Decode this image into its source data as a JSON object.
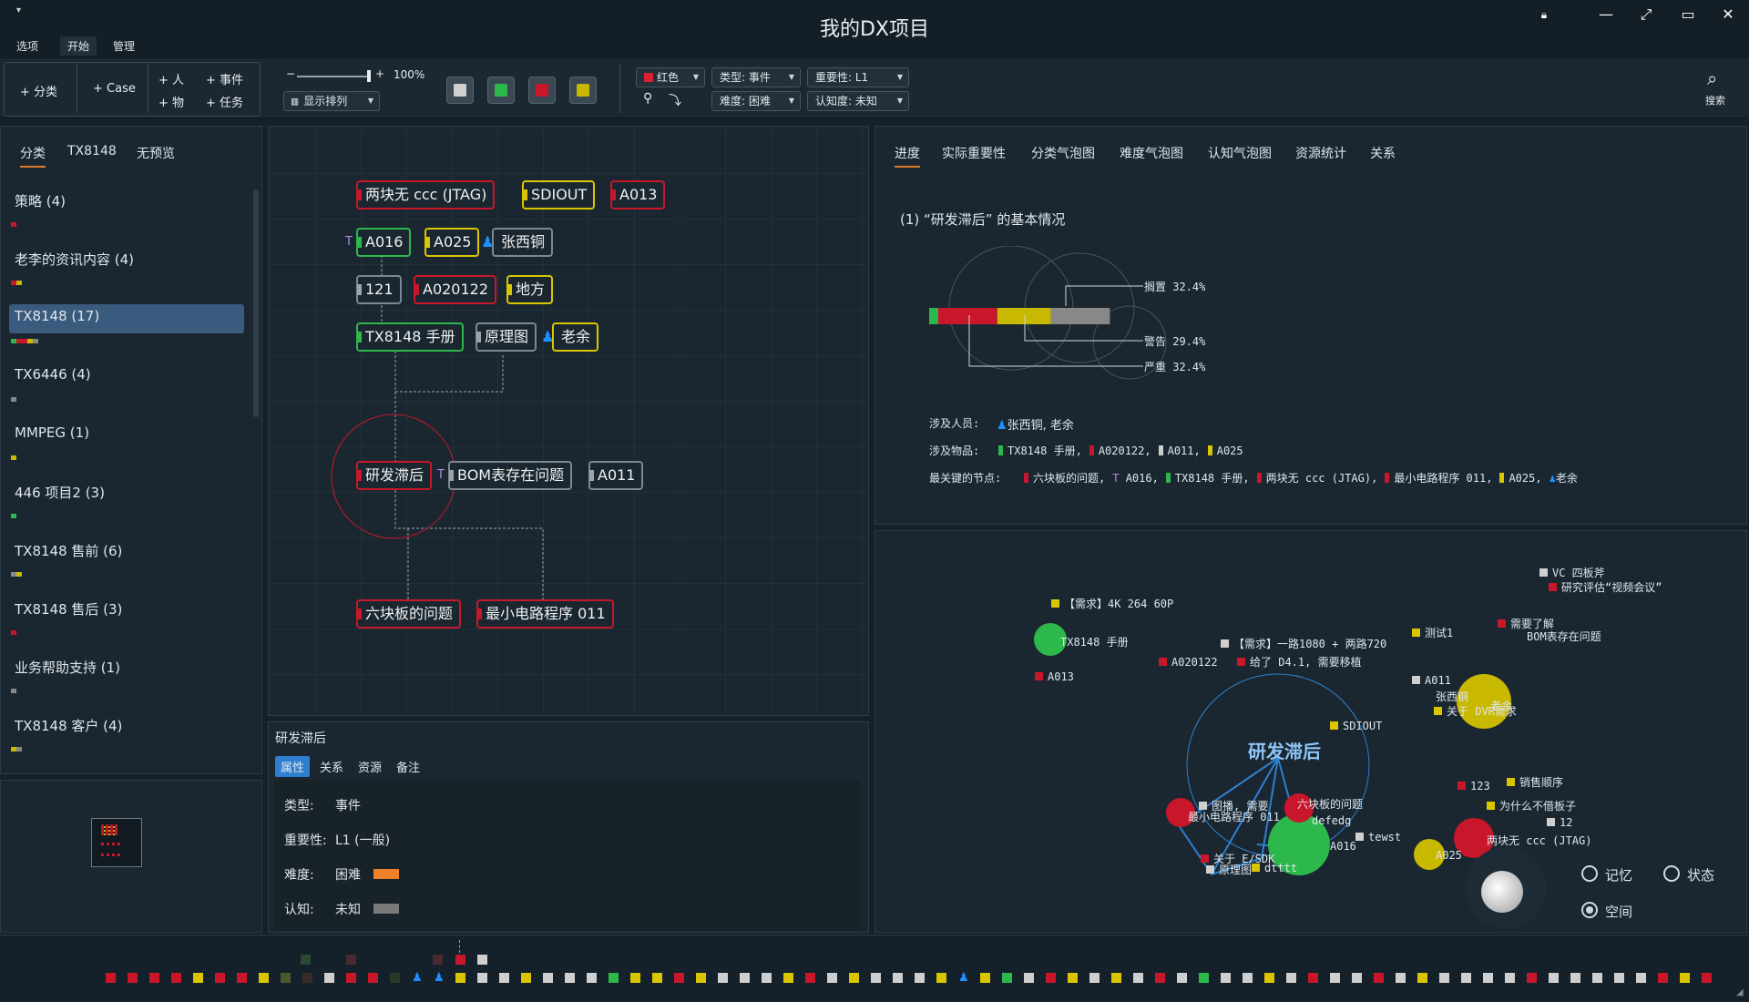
{
  "window": {
    "title": "我的DX项目"
  },
  "menu": [
    "选项",
    "开始",
    "管理"
  ],
  "ribbon": {
    "add_category": "+ 分类",
    "add_case": "+ Case",
    "add_person": "+ 人",
    "add_event": "+ 事件",
    "add_item": "+ 物",
    "add_task": "+ 任务",
    "zoom": "100%",
    "zoom_minus": "−",
    "zoom_plus": "+",
    "display_mode": "显示排列",
    "color_filter": "红色",
    "type_filter": "类型: 事件",
    "importance_filter": "重要性: L1",
    "difficulty_filter": "难度: 困难",
    "cognition_filter": "认知度: 未知",
    "search": "搜索",
    "swatch_colors": [
      "#d0d0d0",
      "#2db84c",
      "#c8172a",
      "#c9b800"
    ]
  },
  "left": {
    "tabs": [
      "分类",
      "TX8148",
      "无预览"
    ],
    "categories": [
      {
        "label": "策略 (4)",
        "bar": [
          "#c8172a"
        ]
      },
      {
        "label": "老李的资讯内容 (4)",
        "bar": [
          "#c8172a",
          "#c9b800"
        ]
      },
      {
        "label": "TX8148 (17)",
        "bar": [
          "#2db84c",
          "#c8172a",
          "#c8172a",
          "#c9b800",
          "#888888"
        ]
      },
      {
        "label": "TX6446 (4)",
        "bar": [
          "#888888"
        ]
      },
      {
        "label": "MMPEG (1)",
        "bar": [
          "#c9b800"
        ]
      },
      {
        "label": "446 项目2 (3)",
        "bar": [
          "#2db84c"
        ]
      },
      {
        "label": "TX8148 售前 (6)",
        "bar": [
          "#888888",
          "#c9b800"
        ]
      },
      {
        "label": "TX8148 售后 (3)",
        "bar": [
          "#c8172a"
        ]
      },
      {
        "label": "业务帮助支持 (1)",
        "bar": [
          "#888888"
        ]
      },
      {
        "label": "TX8148 客户 (4)",
        "bar": [
          "#c9b800",
          "#888888"
        ]
      }
    ]
  },
  "graph": {
    "nodes": [
      {
        "id": "n1",
        "label": "两块无 ccc (JTAG)",
        "color": "red",
        "mark": "#c8172a"
      },
      {
        "id": "n2",
        "label": "SDIOUT",
        "color": "yellow",
        "mark": "#d9c600"
      },
      {
        "id": "n3",
        "label": "A013",
        "color": "red",
        "mark": "#c8172a"
      },
      {
        "id": "n4",
        "label": "A016",
        "color": "green",
        "mark": "#2db84c",
        "prefix": "T"
      },
      {
        "id": "n5",
        "label": "A025",
        "color": "yellow",
        "mark": "#d9c600"
      },
      {
        "id": "n6",
        "label": "张西铜",
        "color": "gray",
        "mark": "person"
      },
      {
        "id": "n7",
        "label": "121",
        "color": "gray",
        "mark": "#9aa4ab"
      },
      {
        "id": "n8",
        "label": "A020122",
        "color": "red",
        "mark": "#c8172a"
      },
      {
        "id": "n9",
        "label": "地方",
        "color": "yellow",
        "mark": "#d9c600"
      },
      {
        "id": "n10",
        "label": "TX8148 手册",
        "color": "green",
        "mark": "#2db84c"
      },
      {
        "id": "n11",
        "label": "原理图",
        "color": "gray",
        "mark": "#9aa4ab"
      },
      {
        "id": "n12",
        "label": "老余",
        "color": "yellow",
        "mark": "person"
      },
      {
        "id": "n13",
        "label": "研发滞后",
        "color": "red",
        "mark": "#c8172a"
      },
      {
        "id": "n14",
        "label": "BOM表存在问题",
        "color": "gray",
        "mark": "#9aa4ab",
        "prefix": "T"
      },
      {
        "id": "n15",
        "label": "A011",
        "color": "gray",
        "mark": "#9aa4ab"
      },
      {
        "id": "n16",
        "label": "六块板的问题",
        "color": "red",
        "mark": "#c8172a"
      },
      {
        "id": "n17",
        "label": "最小电路程序 011",
        "color": "red",
        "mark": "#c8172a"
      }
    ]
  },
  "detail": {
    "title": "研发滞后",
    "tabs": [
      "属性",
      "关系",
      "资源",
      "备注"
    ],
    "props": [
      {
        "key": "类型:",
        "value": "事件"
      },
      {
        "key": "重要性:",
        "value": "L1 (一般)"
      },
      {
        "key": "难度:",
        "value": "困难",
        "swatch": "#f07f2a"
      },
      {
        "key": "认知:",
        "value": "未知",
        "swatch": "#7a7a7a"
      }
    ]
  },
  "right": {
    "tabs": [
      "进度",
      "实际重要性",
      "分类气泡图",
      "难度气泡图",
      "认知气泡图",
      "资源统计",
      "关系"
    ],
    "heading": "(1) “研发滞后” 的基本情况",
    "progress": [
      {
        "label": "搁置",
        "value": 32.4,
        "text": "搁置 32.4%",
        "color": "#888888"
      },
      {
        "label": "警告",
        "value": 29.4,
        "text": "警告 29.4%",
        "color": "#c9b800"
      },
      {
        "label": "严重",
        "value": 32.4,
        "text": "严重 32.4%",
        "color": "#c8172a"
      }
    ],
    "people_label": "涉及人员:",
    "people": "张西铜, 老余",
    "items_label": "涉及物品:",
    "items": [
      {
        "text": "TX8148 手册,",
        "color": "#2db84c"
      },
      {
        "text": "A020122,",
        "color": "#c8172a"
      },
      {
        "text": "A011,",
        "color": "#cfcfcf"
      },
      {
        "text": "A025",
        "color": "#d9c600"
      }
    ],
    "key_label": "最关键的节点:",
    "key_nodes": [
      {
        "text": "六块板的问题,",
        "color": "#c8172a"
      },
      {
        "text": "A016,",
        "color": "T"
      },
      {
        "text": "TX8148 手册,",
        "color": "#2db84c"
      },
      {
        "text": "两块无 ccc (JTAG),",
        "color": "#c8172a"
      },
      {
        "text": "最小电路程序 011,",
        "color": "#c8172a"
      },
      {
        "text": "A025,",
        "color": "#d9c600"
      },
      {
        "text": "老余",
        "color": "person"
      }
    ]
  },
  "bubble": {
    "center_label": "研发滞后",
    "labels": [
      {
        "text": "VC 四板斧",
        "c": "#cfcfcf"
      },
      {
        "text": "研究评估“视频会议”",
        "c": "#c8172a"
      },
      {
        "text": "【需求】4K 264 60P",
        "c": "#d9c600"
      },
      {
        "text": "TX8148 手册",
        "c": ""
      },
      {
        "text": "【需求】一路1080 + 两路720",
        "c": "#cfcfcf"
      },
      {
        "text": "测试1",
        "c": "#d9c600"
      },
      {
        "text": "需要了解",
        "c": "#c8172a"
      },
      {
        "text": "BOM表存在问题",
        "c": ""
      },
      {
        "text": "A020122",
        "c": "#c8172a"
      },
      {
        "text": "给了 D4.1, 需要移植",
        "c": "#c8172a"
      },
      {
        "text": "A013",
        "c": "#c8172a"
      },
      {
        "text": "A011",
        "c": "#cfcfcf"
      },
      {
        "text": "张西铜",
        "c": ""
      },
      {
        "text": "关于 DVR需求",
        "c": "#d9c600"
      },
      {
        "text": "老余",
        "c": ""
      },
      {
        "text": "SDIOUT",
        "c": "#d9c600"
      },
      {
        "text": "123",
        "c": "#c8172a"
      },
      {
        "text": "销售顺序",
        "c": "#d9c600"
      },
      {
        "text": "为什么不借板子",
        "c": "#d9c600"
      },
      {
        "text": "12",
        "c": "#cfcfcf"
      },
      {
        "text": "两块无 ccc (JTAG)",
        "c": ""
      },
      {
        "text": "A025",
        "c": ""
      },
      {
        "text": "tewst",
        "c": "#cfcfcf"
      },
      {
        "text": "六块板的问题",
        "c": ""
      },
      {
        "text": "最小电路程序 011",
        "c": ""
      },
      {
        "text": "图播, 需要",
        "c": "#cfcfcf"
      },
      {
        "text": "defedg",
        "c": ""
      },
      {
        "text": "A016",
        "c": ""
      },
      {
        "text": "关于 E/SDK",
        "c": "#c8172a"
      },
      {
        "text": "原理图",
        "c": "#cfcfcf"
      },
      {
        "text": "dtttt",
        "c": "#d9c600"
      }
    ],
    "radios": [
      "记忆",
      "状态",
      "空间"
    ],
    "radio_selected": "空间"
  },
  "strip": {
    "colors": [
      "#c8172a",
      "#c8172a",
      "#c8172a",
      "#c8172a",
      "#d9c600",
      "#c8172a",
      "#c8172a",
      "#d9c600",
      "#4a5a2a",
      "#3a2a2a",
      "#cfcfcf",
      "#c8172a",
      "#c8172a",
      "#2a3a2a",
      "#1e90ff",
      "#1e90ff",
      "#d9c600",
      "#cfcfcf",
      "#cfcfcf",
      "#d9c600",
      "#cfcfcf",
      "#cfcfcf",
      "#cfcfcf",
      "#2db84c",
      "#d9c600",
      "#d9c600",
      "#c8172a",
      "#d9c600",
      "#cfcfcf",
      "#cfcfcf",
      "#cfcfcf",
      "#d9c600",
      "#c8172a",
      "#cfcfcf",
      "#d9c600",
      "#cfcfcf",
      "#cfcfcf",
      "#cfcfcf",
      "#d9c600",
      "#1e90ff",
      "#d9c600",
      "#2db84c",
      "#cfcfcf",
      "#c8172a",
      "#d9c600",
      "#cfcfcf",
      "#d9c600",
      "#cfcfcf",
      "#c8172a",
      "#cfcfcf",
      "#2db84c",
      "#cfcfcf",
      "#cfcfcf",
      "#d9c600",
      "#cfcfcf",
      "#c8172a",
      "#cfcfcf",
      "#cfcfcf",
      "#c8172a",
      "#cfcfcf",
      "#d9c600",
      "#cfcfcf",
      "#cfcfcf",
      "#cfcfcf",
      "#cfcfcf",
      "#c8172a",
      "#cfcfcf",
      "#cfcfcf",
      "#cfcfcf",
      "#cfcfcf",
      "#cfcfcf",
      "#c8172a",
      "#d9c600",
      "#c8172a"
    ]
  }
}
